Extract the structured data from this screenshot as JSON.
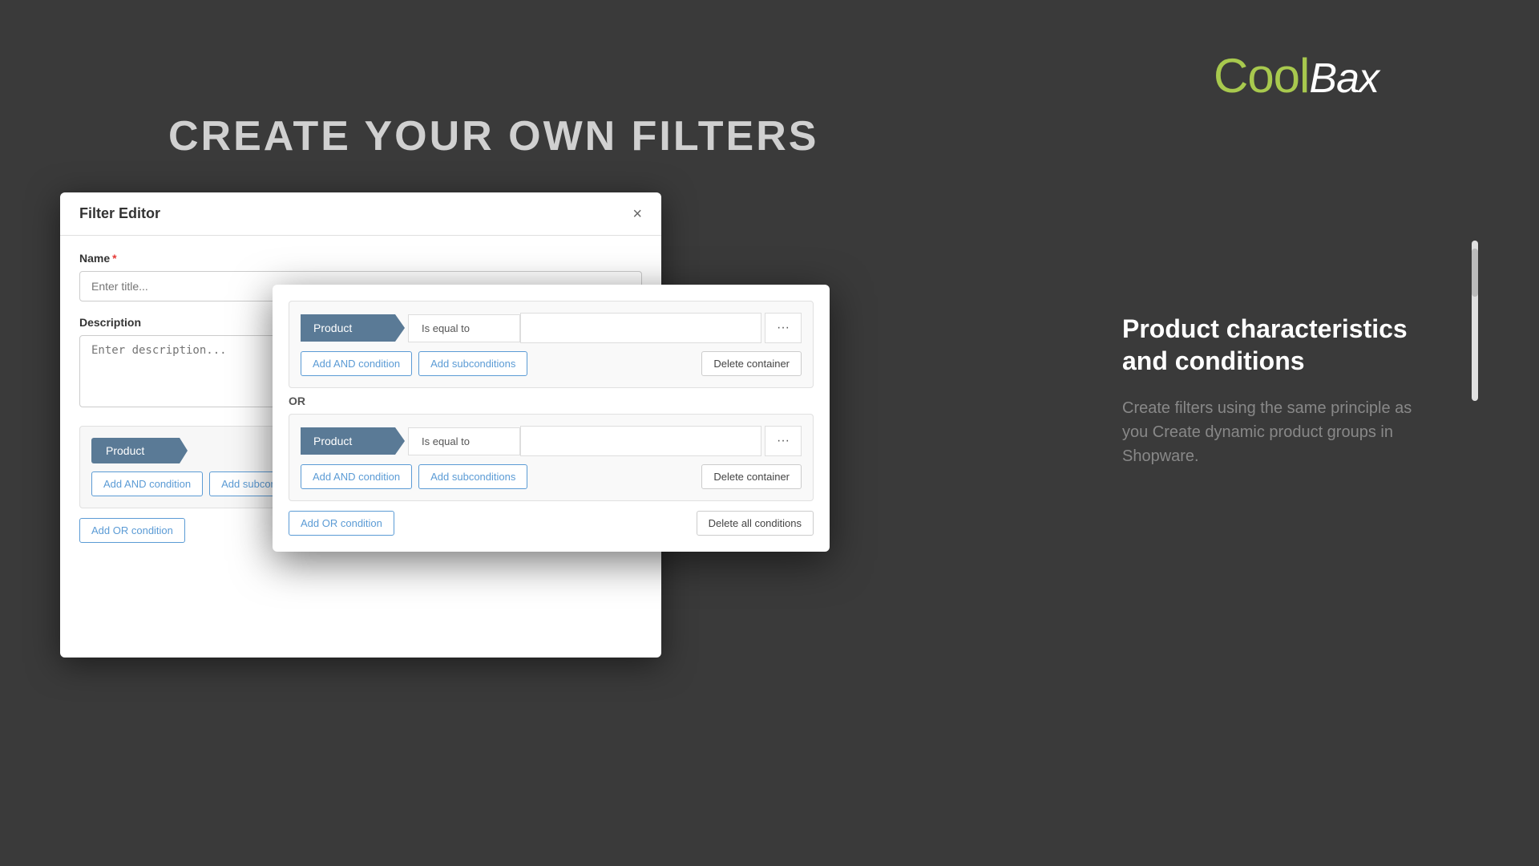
{
  "brand": {
    "cool": "Cool",
    "bax": "Bax"
  },
  "page": {
    "title": "CREATE YOUR OWN FILTERS"
  },
  "right_panel": {
    "title": "Product characteristics and conditions",
    "body": "Create filters using the same principle as you Create dynamic product groups in Shopware."
  },
  "dialog_bg": {
    "title": "Filter Editor",
    "close_label": "×",
    "name_label": "Name",
    "name_placeholder": "Enter title...",
    "description_label": "Description",
    "description_placeholder": "Enter description...",
    "product_tag": "Product",
    "add_and_btn": "Add AND condition",
    "add_sub_btn": "Add subconditions",
    "delete_container_btn": "Delete container",
    "add_or_btn": "Add OR condition",
    "delete_all_btn": "Delete all conditions"
  },
  "dialog_fg": {
    "container1": {
      "product_tag": "Product",
      "condition_label": "Is equal to",
      "add_and_btn": "Add AND condition",
      "add_sub_btn": "Add subconditions",
      "delete_container_btn": "Delete container"
    },
    "or_label": "OR",
    "container2": {
      "product_tag": "Product",
      "condition_label": "Is equal to",
      "add_and_btn": "Add AND condition",
      "add_sub_btn": "Add subconditions",
      "delete_container_btn": "Delete container"
    },
    "add_or_btn": "Add OR condition",
    "delete_all_btn": "Delete all conditions"
  }
}
